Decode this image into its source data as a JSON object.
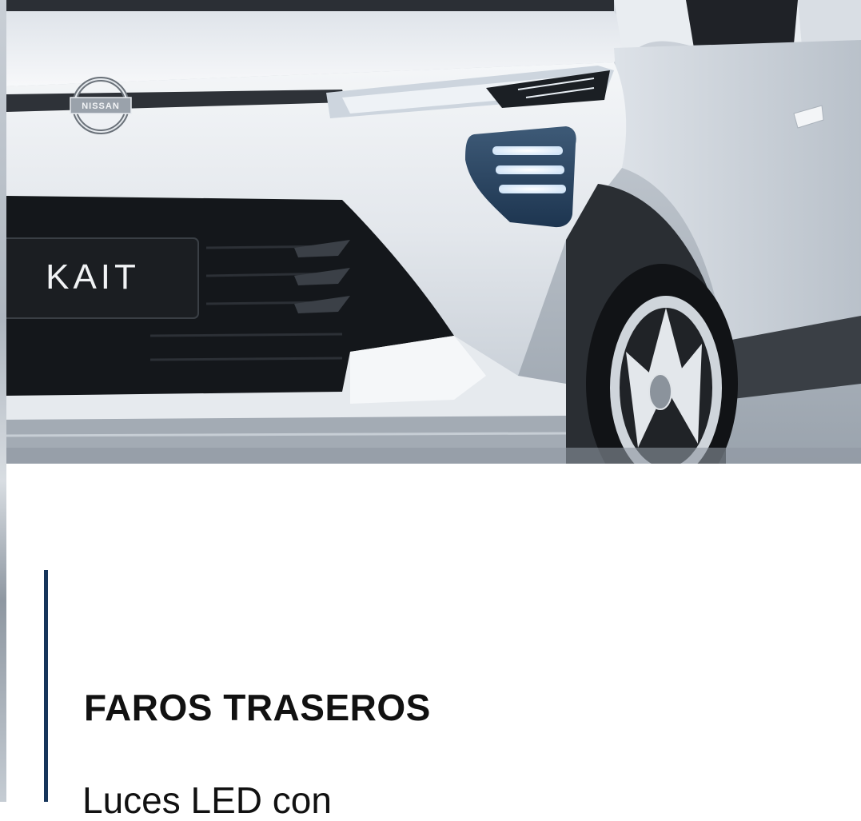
{
  "hero": {
    "plate_text": "KAIT",
    "badge_text": "NISSAN"
  },
  "feature": {
    "title": "FAROS TRASEROS",
    "description": "Luces LED con"
  },
  "colors": {
    "accent": "#16355b",
    "text": "#111111",
    "background": "#ffffff"
  }
}
